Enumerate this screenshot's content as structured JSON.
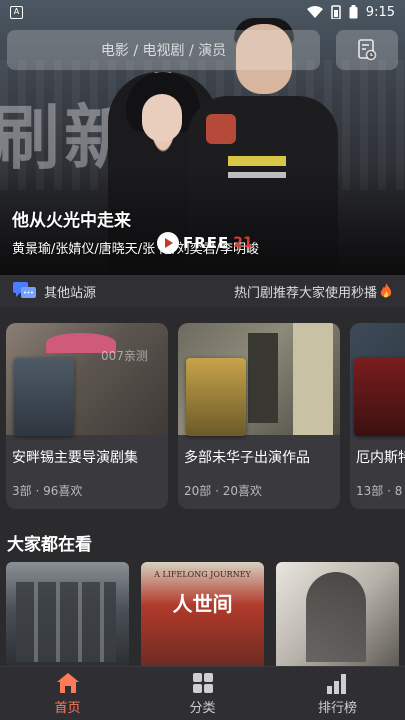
{
  "status_bar": {
    "time": "9:15",
    "app_icon_letter": "A"
  },
  "search": {
    "placeholder": "电影 / 电视剧 / 演员"
  },
  "hero": {
    "title": "他从火光中走来",
    "cast": "黄景瑜/张婧仪/唐晓天/张  阳/刘奕君/李明峻",
    "bg_text": "刷新",
    "logo_text": "FREE",
    "logo_suffix": "21"
  },
  "info_row": {
    "sites_label": "其他站源",
    "notice": "热门剧推荐大家使用秒播",
    "notice_icon": "fire-icon"
  },
  "cards": [
    {
      "title": "安畔锡主要导演剧集",
      "meta": "3部 · 96喜欢",
      "overlay": "007亲测"
    },
    {
      "title": "多部未华子出演作品",
      "meta": "20部 · 20喜欢",
      "overlay": ""
    },
    {
      "title": "厄内斯特",
      "meta": "13部 · 8",
      "overlay": ""
    }
  ],
  "section": {
    "title": "大家都在看"
  },
  "posters": [
    {
      "label": "",
      "caption": ""
    },
    {
      "label": "A LIFELONG JOURNEY",
      "caption": "人世间"
    },
    {
      "label": "",
      "caption": ""
    }
  ],
  "tabs": [
    {
      "label": "首页",
      "icon": "home-icon",
      "active": true
    },
    {
      "label": "分类",
      "icon": "grid-icon",
      "active": false
    },
    {
      "label": "排行榜",
      "icon": "bar-chart-icon",
      "active": false
    }
  ],
  "colors": {
    "accent": "#ff7a59",
    "background": "#2b2b2e"
  }
}
